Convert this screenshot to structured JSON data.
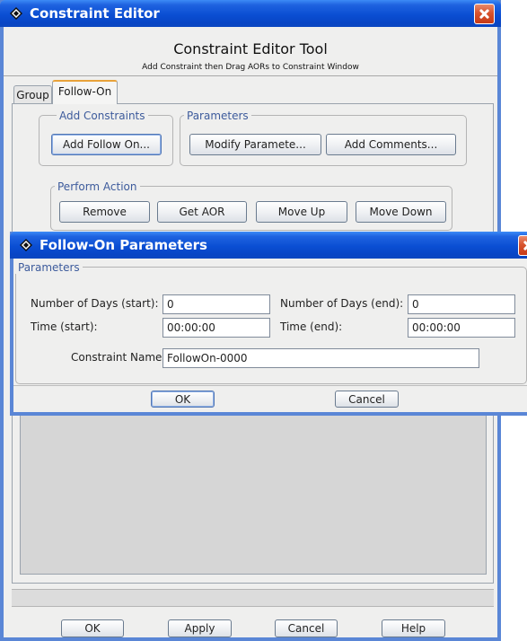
{
  "main_window": {
    "title": "Constraint Editor",
    "header_title": "Constraint Editor Tool",
    "header_subtitle": "Add Constraint then Drag AORs to Constraint Window",
    "tabs": [
      {
        "label": "Group",
        "selected": false
      },
      {
        "label": "Follow-On",
        "selected": true
      }
    ],
    "add_constraints": {
      "label": "Add Constraints",
      "add_follow_on_button": "Add Follow On..."
    },
    "parameters": {
      "label": "Parameters",
      "modify_button": "Modify Paramete...",
      "comments_button": "Add Comments..."
    },
    "perform_action": {
      "label": "Perform Action",
      "remove_button": "Remove",
      "get_aor_button": "Get AOR",
      "move_up_button": "Move Up",
      "move_down_button": "Move Down"
    },
    "footer": {
      "ok_button": "OK",
      "apply_button": "Apply",
      "cancel_button": "Cancel",
      "help_button": "Help"
    }
  },
  "dialog": {
    "title": "Follow-On Parameters",
    "group_label": "Parameters",
    "days_start_label": "Number of Days (start):",
    "days_start_value": "0",
    "days_end_label": "Number of Days (end):",
    "days_end_value": "0",
    "time_start_label": "Time (start):",
    "time_start_value": "00:00:00",
    "time_end_label": "Time (end):",
    "time_end_value": "00:00:00",
    "constraint_name_label": "Constraint Name:",
    "constraint_name_value": "FollowOn-0000",
    "ok_button": "OK",
    "cancel_button": "Cancel"
  },
  "colors": {
    "titlebar_blue": "#0a4ed3",
    "close_red": "#d8532d",
    "panel_gray": "#efefee",
    "list_gray": "#d6d6d6",
    "group_label_blue": "#3d5b9c"
  },
  "icons": {
    "app": "diamond-app-icon",
    "close": "close-icon"
  }
}
